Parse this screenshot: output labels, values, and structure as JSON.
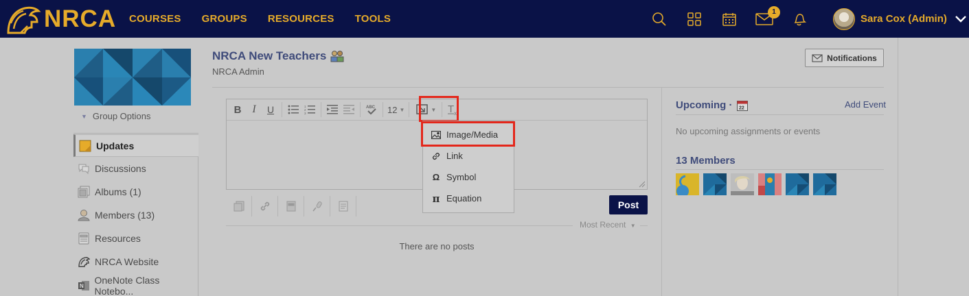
{
  "header": {
    "brand": "NRCA",
    "nav": [
      "COURSES",
      "GROUPS",
      "RESOURCES",
      "TOOLS"
    ],
    "mail_badge": "1",
    "user_name": "Sara Cox (Admin)",
    "icons": [
      "search-icon",
      "apps-grid-icon",
      "calendar-icon",
      "mail-icon",
      "bell-icon",
      "chevron-down-icon"
    ]
  },
  "sidebar": {
    "group_options": "Group Options",
    "items": [
      {
        "label": "Updates",
        "icon": "updates-icon"
      },
      {
        "label": "Discussions",
        "icon": "discussions-icon"
      },
      {
        "label": "Albums (1)",
        "icon": "albums-icon"
      },
      {
        "label": "Members (13)",
        "icon": "members-icon"
      },
      {
        "label": "Resources",
        "icon": "resources-icon"
      },
      {
        "label": "NRCA Website",
        "icon": "nrca-helmet-icon"
      },
      {
        "label": "OneNote Class Notebo...",
        "icon": "onenote-icon"
      }
    ]
  },
  "main": {
    "title": "NRCA New Teachers",
    "subtitle": "NRCA Admin",
    "notifications_label": "Notifications",
    "editor": {
      "font_size": "12",
      "insert_menu": [
        "Image/Media",
        "Link",
        "Symbol",
        "Equation"
      ]
    },
    "post_label": "Post",
    "sort_label": "Most Recent",
    "empty_label": "There are no posts"
  },
  "right": {
    "upcoming_title": "Upcoming ·",
    "calendar_day": "22",
    "add_event": "Add Event",
    "upcoming_empty": "No upcoming assignments or events",
    "members_title": "13 Members"
  },
  "colors": {
    "nav_bg": "#0a1247",
    "brand_gold": "#e6ab2a",
    "highlight_red": "#e4261a",
    "heading_blue": "#3f4b7a"
  }
}
